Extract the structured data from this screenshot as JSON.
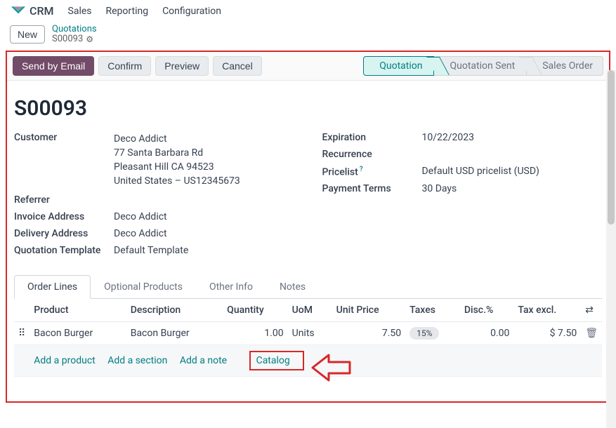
{
  "nav": {
    "brand": "CRM",
    "items": [
      "Sales",
      "Reporting",
      "Configuration"
    ]
  },
  "breadcrumb": {
    "new_label": "New",
    "parent": "Quotations",
    "current": "S00093"
  },
  "statusbar": {
    "send_email": "Send by Email",
    "confirm": "Confirm",
    "preview": "Preview",
    "cancel": "Cancel",
    "stages": [
      "Quotation",
      "Quotation Sent",
      "Sales Order"
    ]
  },
  "record": {
    "title": "S00093"
  },
  "left_fields": {
    "customer_label": "Customer",
    "customer_name": "Deco Addict",
    "addr1": "77 Santa Barbara Rd",
    "addr2": "Pleasant Hill CA 94523",
    "addr3": "United States – US12345673",
    "referrer_label": "Referrer",
    "invoice_label": "Invoice Address",
    "invoice_val": "Deco Addict",
    "delivery_label": "Delivery Address",
    "delivery_val": "Deco Addict",
    "template_label": "Quotation Template",
    "template_val": "Default Template"
  },
  "right_fields": {
    "expiration_label": "Expiration",
    "expiration_val": "10/22/2023",
    "recurrence_label": "Recurrence",
    "pricelist_label": "Pricelist",
    "pricelist_val": "Default USD pricelist (USD)",
    "terms_label": "Payment Terms",
    "terms_val": "30 Days"
  },
  "tabs": [
    "Order Lines",
    "Optional Products",
    "Other Info",
    "Notes"
  ],
  "table": {
    "headers": {
      "product": "Product",
      "description": "Description",
      "quantity": "Quantity",
      "uom": "UoM",
      "unit_price": "Unit Price",
      "taxes": "Taxes",
      "disc": "Disc.%",
      "tax_excl": "Tax excl."
    },
    "rows": [
      {
        "product": "Bacon Burger",
        "description": "Bacon Burger",
        "quantity": "1.00",
        "uom": "Units",
        "unit_price": "7.50",
        "taxes": "15%",
        "disc": "0.00",
        "tax_excl": "$ 7.50"
      }
    ],
    "add_product": "Add a product",
    "add_section": "Add a section",
    "add_note": "Add a note",
    "catalog": "Catalog"
  }
}
